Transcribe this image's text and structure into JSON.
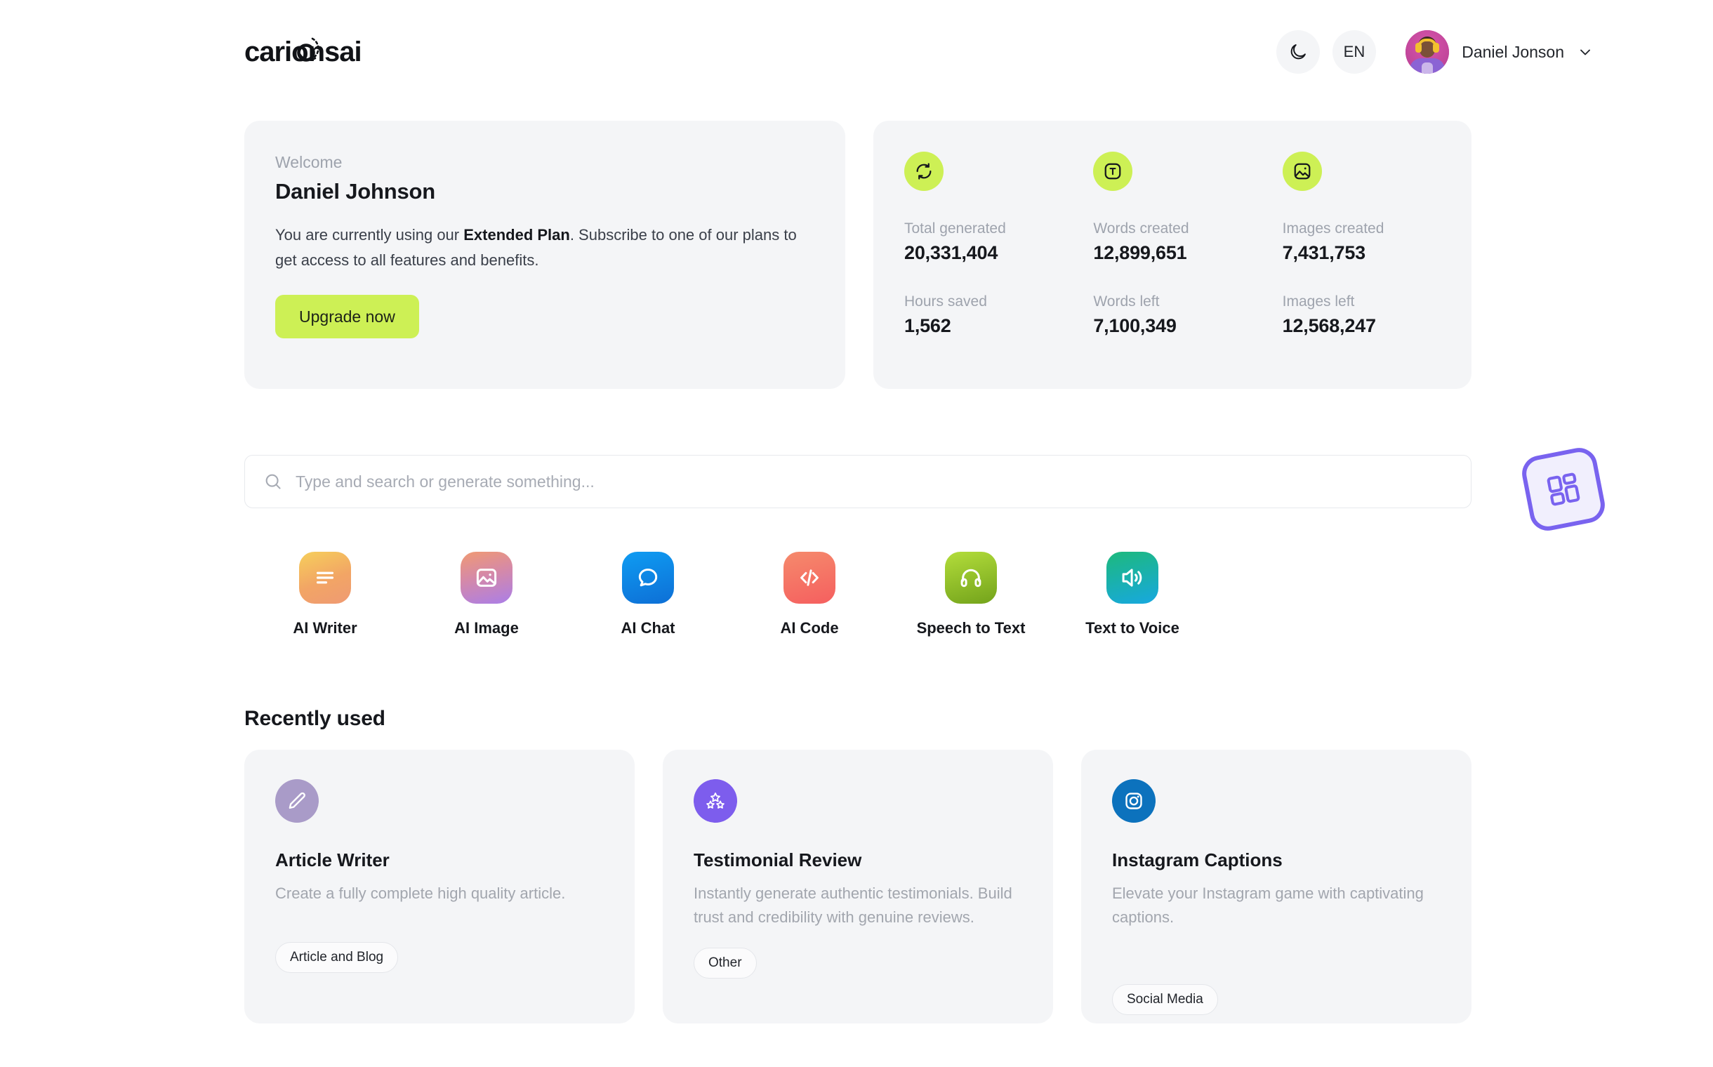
{
  "brand": {
    "name": "carionsai"
  },
  "header": {
    "theme_toggle_icon": "moon-icon",
    "language": "EN",
    "user_name": "Daniel Jonson",
    "chevron_icon": "chevron-down-icon"
  },
  "welcome": {
    "label": "Welcome",
    "name": "Daniel Johnson",
    "desc_before": "You are currently using our ",
    "plan": "Extended Plan",
    "desc_after": ". Subscribe to one of our plans to get access to all features and benefits.",
    "upgrade_label": "Upgrade now",
    "accent_color": "#cdf055"
  },
  "stats": [
    {
      "icon": "refresh-icon",
      "top_label": "Total generated",
      "top_value": "20,331,404",
      "bottom_label": "Hours saved",
      "bottom_value": "1,562"
    },
    {
      "icon": "text-box-icon",
      "top_label": "Words created",
      "top_value": "12,899,651",
      "bottom_label": "Words left",
      "bottom_value": "7,100,349"
    },
    {
      "icon": "image-icon",
      "top_label": "Images created",
      "top_value": "7,431,753",
      "bottom_label": "Images left",
      "bottom_value": "12,568,247"
    }
  ],
  "search": {
    "placeholder": "Type and search or generate something...",
    "value": "",
    "icon": "search-icon"
  },
  "fab": {
    "icon": "dashboard-grid-icon",
    "color": "#7963ef"
  },
  "tools": [
    {
      "label": "AI Writer",
      "icon": "text-lines-icon"
    },
    {
      "label": "AI Image",
      "icon": "image-icon"
    },
    {
      "label": "AI Chat",
      "icon": "chat-bubble-icon"
    },
    {
      "label": "AI Code",
      "icon": "code-brackets-icon"
    },
    {
      "label": "Speech to Text",
      "icon": "headphones-icon"
    },
    {
      "label": "Text to Voice",
      "icon": "speaker-icon"
    }
  ],
  "recent": {
    "title": "Recently used",
    "items": [
      {
        "icon": "pencil-icon",
        "name": "Article Writer",
        "desc": "Create a fully complete high quality article.",
        "tag": "Article and Blog"
      },
      {
        "icon": "stars-icon",
        "name": "Testimonial Review",
        "desc": "Instantly generate authentic testimonials. Build trust and credibility with genuine reviews.",
        "tag": "Other"
      },
      {
        "icon": "instagram-icon",
        "name": "Instagram Captions",
        "desc": "Elevate your Instagram game with captivating captions.",
        "tag": "Social Media"
      }
    ]
  }
}
